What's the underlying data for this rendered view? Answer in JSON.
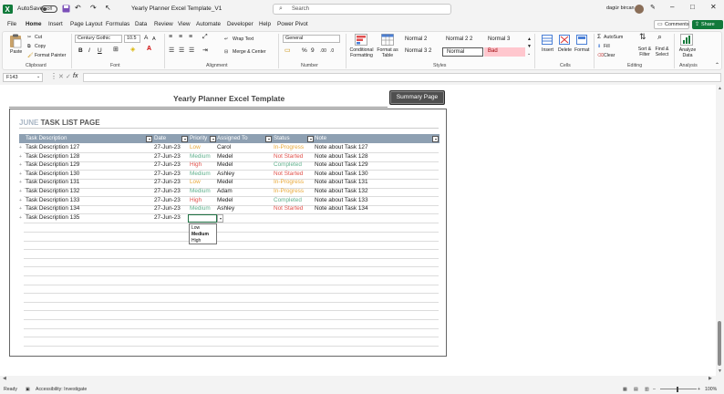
{
  "titlebar": {
    "autosave_label": "AutoSave",
    "autosave_state": "Off",
    "file_name": "Yearly Planner Excel Template_V1",
    "search_placeholder": "Search",
    "user_name": "dagür bircan"
  },
  "menu": {
    "items": [
      "File",
      "Home",
      "Insert",
      "Page Layout",
      "Formulas",
      "Data",
      "Review",
      "View",
      "Automate",
      "Developer",
      "Help",
      "Power Pivot"
    ],
    "active": "Home",
    "comments_label": "Comments",
    "share_label": "Share"
  },
  "ribbon": {
    "clipboard": {
      "paste": "Paste",
      "cut": "Cut",
      "copy": "Copy",
      "format_painter": "Format Painter",
      "label": "Clipboard"
    },
    "font": {
      "family": "Century Gothic",
      "size": "10.5",
      "bold": "B",
      "italic": "I",
      "underline": "U",
      "grow": "A",
      "shrink": "A",
      "label": "Font"
    },
    "alignment": {
      "wrap": "Wrap Text",
      "merge": "Merge & Center",
      "label": "Alignment"
    },
    "number": {
      "format": "General",
      "label": "Number"
    },
    "styles": {
      "conditional": "Conditional Formatting",
      "format_table": "Format as Table",
      "cells": [
        {
          "name": "Normal 2",
          "bg": "#ffffff",
          "fg": "#222222"
        },
        {
          "name": "Normal 2 2",
          "bg": "#ffffff",
          "fg": "#222222"
        },
        {
          "name": "Normal 3",
          "bg": "#ffffff",
          "fg": "#222222"
        },
        {
          "name": "Normal 3 2",
          "bg": "#ffffff",
          "fg": "#222222"
        },
        {
          "name": "Normal",
          "bg": "#ffffff",
          "fg": "#222222"
        },
        {
          "name": "Bad",
          "bg": "#ffc7ce",
          "fg": "#9c0006"
        }
      ],
      "label": "Styles"
    },
    "cells": {
      "insert": "Insert",
      "delete": "Delete",
      "format": "Format",
      "label": "Cells"
    },
    "editing": {
      "autosum": "AutoSum",
      "fill": "Fill",
      "clear": "Clear",
      "sort": "Sort & Filter",
      "find": "Find & Select",
      "label": "Editing"
    },
    "analysis": {
      "analyze": "Analyze Data",
      "label": "Analysis"
    }
  },
  "formula_bar": {
    "name_box": "F143",
    "fx": "fx",
    "value": ""
  },
  "sheet": {
    "title": "Yearly Planner Excel Template",
    "summary_button": "Summary Page",
    "month": "JUNE",
    "page_label": "TASK LIST PAGE",
    "columns": [
      "Task Description",
      "Date",
      "Priority",
      "Assigned To",
      "Status",
      "Note"
    ],
    "rows": [
      {
        "task": "Task Description 127",
        "date": "27-Jun-23",
        "priority": "Low",
        "assigned": "Carol",
        "status": "In-Progress",
        "note": "Note about Task 127"
      },
      {
        "task": "Task Description 128",
        "date": "27-Jun-23",
        "priority": "Medium",
        "assigned": "Medel",
        "status": "Not Started",
        "note": "Note about Task 128"
      },
      {
        "task": "Task Description 129",
        "date": "27-Jun-23",
        "priority": "High",
        "assigned": "Medel",
        "status": "Completed",
        "note": "Note about Task 129"
      },
      {
        "task": "Task Description 130",
        "date": "27-Jun-23",
        "priority": "Medium",
        "assigned": "Ashley",
        "status": "Not Started",
        "note": "Note about Task 130"
      },
      {
        "task": "Task Description 131",
        "date": "27-Jun-23",
        "priority": "Low",
        "assigned": "Medel",
        "status": "In-Progress",
        "note": "Note about Task 131"
      },
      {
        "task": "Task Description 132",
        "date": "27-Jun-23",
        "priority": "Medium",
        "assigned": "Adam",
        "status": "In-Progress",
        "note": "Note about Task 132"
      },
      {
        "task": "Task Description 133",
        "date": "27-Jun-23",
        "priority": "High",
        "assigned": "Medel",
        "status": "Completed",
        "note": "Note about Task 133"
      },
      {
        "task": "Task Description 134",
        "date": "27-Jun-23",
        "priority": "Medium",
        "assigned": "Ashley",
        "status": "Not Started",
        "note": "Note about Task 134"
      },
      {
        "task": "Task Description 135",
        "date": "27-Jun-23",
        "priority": "",
        "assigned": "",
        "status": "",
        "note": ""
      }
    ],
    "priority_options": [
      "Low",
      "Medium",
      "High"
    ],
    "priority_selected": "Medium",
    "colors": {
      "Low": "#e8a838",
      "Medium": "#5fb08c",
      "High": "#e0504a",
      "In-Progress": "#e8a838",
      "Not Started": "#e0504a",
      "Completed": "#5fb08c",
      "header_bg": "#8ea0b2",
      "accent": "#117a3b"
    }
  },
  "status_bar": {
    "ready": "Ready",
    "accessibility": "Accessibility: Investigate",
    "zoom": "100%"
  }
}
